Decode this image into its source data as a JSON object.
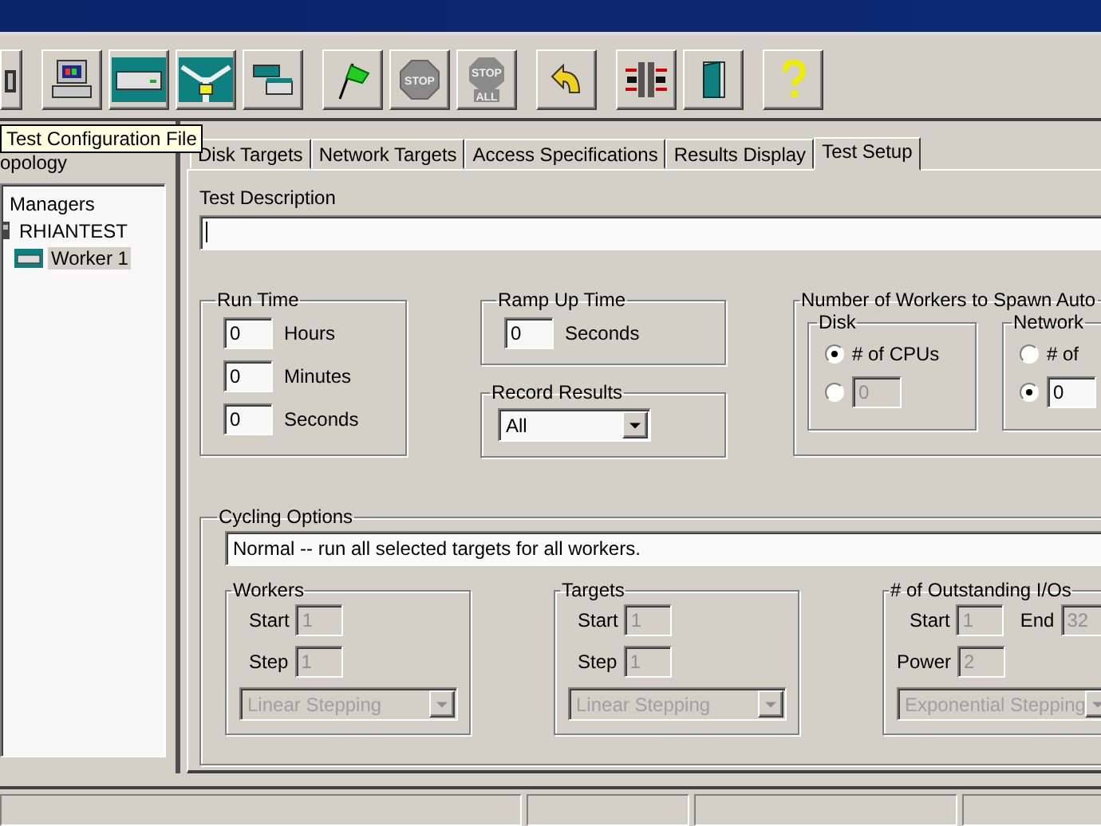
{
  "toolbar": {
    "groups": [
      [
        {
          "kind": "partial"
        }
      ],
      [
        {
          "kind": "computer"
        },
        {
          "kind": "disk"
        },
        {
          "kind": "network"
        },
        {
          "kind": "copy"
        }
      ],
      [
        {
          "kind": "start"
        },
        {
          "kind": "stop",
          "label": "STOP"
        },
        {
          "kind": "stop-all",
          "label": "STOP",
          "sublabel": "ALL"
        }
      ],
      [
        {
          "kind": "reset"
        }
      ],
      [
        {
          "kind": "split"
        },
        {
          "kind": "exit"
        }
      ],
      [
        {
          "kind": "help"
        }
      ]
    ]
  },
  "tooltip": "Test Configuration File",
  "topology": {
    "title": "opology",
    "tree": [
      {
        "label": "Managers",
        "children": [
          {
            "label": "RHIANTEST",
            "selected": false,
            "children": [
              {
                "label": "Worker 1",
                "selected": true
              }
            ]
          }
        ]
      }
    ]
  },
  "tabs": [
    {
      "label": "Disk Targets",
      "selected": false
    },
    {
      "label": "Network Targets",
      "selected": false
    },
    {
      "label": "Access Specifications",
      "selected": false
    },
    {
      "label": "Results Display",
      "selected": false
    },
    {
      "label": "Test Setup",
      "selected": true
    }
  ],
  "test_description": {
    "label": "Test Description"
  },
  "run_time": {
    "title": "Run Time",
    "fields": [
      {
        "value": "0",
        "unit": "Hours"
      },
      {
        "value": "0",
        "unit": "Minutes"
      },
      {
        "value": "0",
        "unit": "Seconds"
      }
    ]
  },
  "ramp_up": {
    "title": "Ramp Up Time",
    "value": "0",
    "unit": "Seconds"
  },
  "record_results": {
    "title": "Record Results",
    "value": "All"
  },
  "spawn": {
    "title": "Number of Workers to Spawn Auto",
    "groups": [
      {
        "title": "Disk",
        "options": [
          {
            "kind": "label",
            "label": "# of CPUs",
            "selected": true
          },
          {
            "kind": "field",
            "value": "0",
            "selected": false,
            "disabled": true
          }
        ]
      },
      {
        "title": "Network",
        "options": [
          {
            "kind": "label",
            "label": "# of",
            "selected": false
          },
          {
            "kind": "field",
            "value": "0",
            "selected": true,
            "disabled": false
          }
        ]
      }
    ]
  },
  "cycling": {
    "title": "Cycling Options",
    "mode": "Normal -- run all selected targets for all workers.",
    "groups": [
      {
        "title": "Workers",
        "rows": [
          [
            {
              "label": "Start",
              "value": "1"
            }
          ],
          [
            {
              "label": "Step",
              "value": "1"
            }
          ]
        ],
        "stepping": "Linear Stepping",
        "disabled": true
      },
      {
        "title": "Targets",
        "rows": [
          [
            {
              "label": "Start",
              "value": "1"
            }
          ],
          [
            {
              "label": "Step",
              "value": "1"
            }
          ]
        ],
        "stepping": "Linear Stepping",
        "disabled": true
      },
      {
        "title": "# of Outstanding I/Os",
        "rows": [
          [
            {
              "label": "Start",
              "value": "1"
            },
            {
              "label": "End",
              "value": "32"
            }
          ],
          [
            {
              "label": "Power",
              "value": "2"
            }
          ]
        ],
        "stepping": "Exponential Stepping",
        "disabled": true
      }
    ]
  }
}
